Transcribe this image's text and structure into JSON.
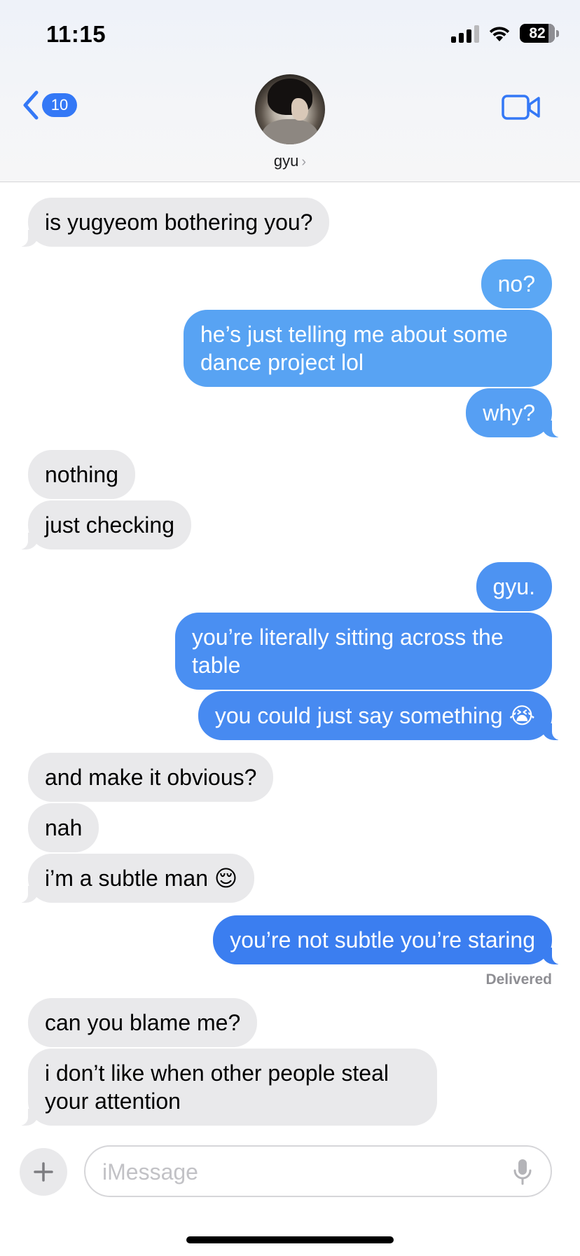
{
  "status_bar": {
    "time": "11:15",
    "battery": "82"
  },
  "header": {
    "back_count": "10",
    "contact_name": "gyu",
    "contact_chevron": "›"
  },
  "messages": [
    {
      "dir": "in",
      "text": "is yugyeom bothering you?"
    },
    {
      "dir": "out",
      "text": "no?"
    },
    {
      "dir": "out",
      "text": "he’s just telling me about some dance project lol"
    },
    {
      "dir": "out",
      "text": "why?"
    },
    {
      "dir": "in",
      "text": "nothing"
    },
    {
      "dir": "in",
      "text": "just checking"
    },
    {
      "dir": "out",
      "text": "gyu."
    },
    {
      "dir": "out",
      "text": "you’re literally sitting across the table"
    },
    {
      "dir": "out",
      "text": "you could just say something 😭"
    },
    {
      "dir": "in",
      "text": "and make it obvious?"
    },
    {
      "dir": "in",
      "text": "nah"
    },
    {
      "dir": "in",
      "text": "i’m a subtle man 😌"
    },
    {
      "dir": "out",
      "text": "you’re not subtle you’re staring"
    },
    {
      "dir": "in",
      "text": "can you blame me?"
    },
    {
      "dir": "in",
      "text": "i don’t like when other people steal your attention"
    }
  ],
  "delivered_label": "Delivered",
  "input": {
    "placeholder": "iMessage"
  },
  "icons": {
    "back": "chevron-left-icon",
    "video": "video-camera-icon",
    "plus": "plus-icon",
    "mic": "microphone-icon",
    "signal": "cellular-signal-icon",
    "wifi": "wifi-icon",
    "battery": "battery-icon"
  },
  "colors": {
    "accent": "#3478f6",
    "incoming_bubble": "#e9e9eb",
    "outgoing_top": "#5aa6f3",
    "outgoing_bottom": "#3b7cf0"
  }
}
